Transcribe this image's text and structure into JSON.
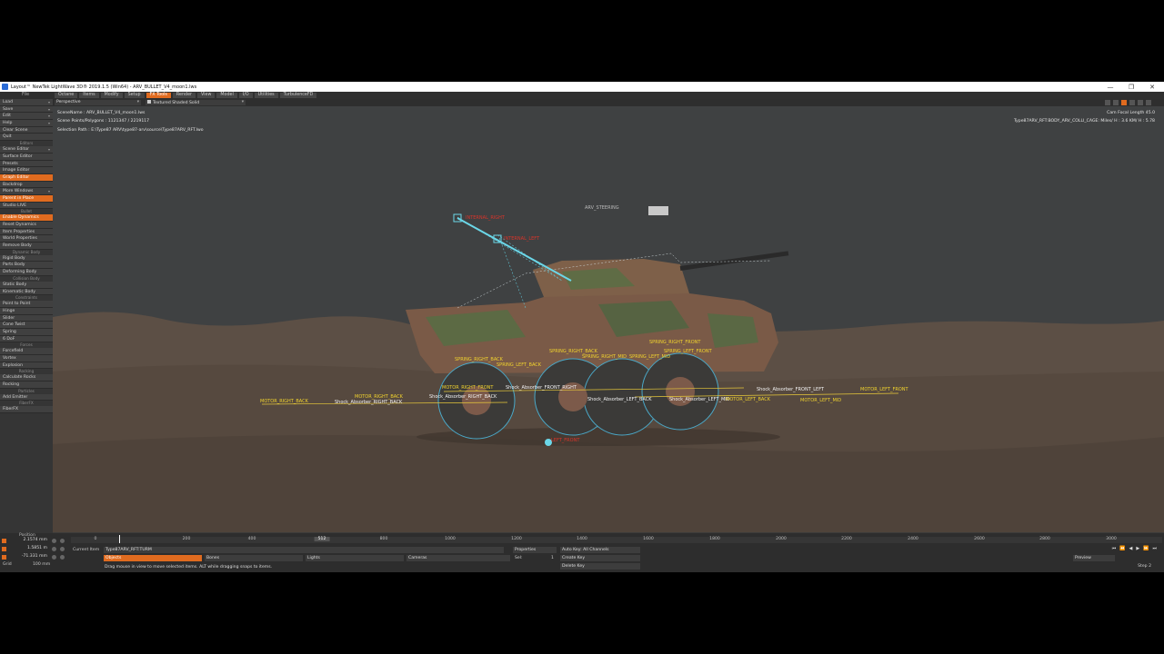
{
  "window": {
    "title": "Layout™ NewTek LightWave 3D® 2019.1.5 (Win64) - ARV_BULLET_V4_moon1.lws",
    "controls": [
      "—",
      "❐",
      "✕"
    ]
  },
  "menubar": {
    "file_label": "File",
    "tabs": [
      "Octane",
      "Items",
      "Modify",
      "Setup",
      "FX Tools",
      "Render",
      "View",
      "Model",
      "I/O",
      "Utilities",
      "TurbulenceFD"
    ],
    "active_tab": "FX Tools"
  },
  "sidebar": {
    "top": [
      "Load",
      "Save",
      "Edit",
      "Help"
    ],
    "clear": [
      "Clear Scene",
      "Quit"
    ],
    "editors_title": "Editors",
    "editors": [
      "Scene Editor",
      "Surface Editor",
      "Presets",
      "Image Editor",
      "Graph Editor",
      "Backdrop",
      "More Windows",
      "Parent in Place",
      "Studio LIVE"
    ],
    "bullet_title": "Bullet",
    "bullet": [
      "Enable Dynamics",
      "Reset Dynamics",
      "Item Properties",
      "World Properties",
      "Remove Body"
    ],
    "dynamic_title": "Dynamic Body",
    "dynamic": [
      "Rigid Body",
      "Parts Body",
      "Deforming Body"
    ],
    "collision_title": "Collision Body",
    "collision": [
      "Static Body",
      "Kinematic Body"
    ],
    "constraints_title": "Constraints",
    "constraints": [
      "Point to Point",
      "Hinge",
      "Slider",
      "Cone Twist",
      "Spring",
      "6 DoF"
    ],
    "forces_title": "Forces",
    "forces": [
      "Forcefield",
      "Vortex",
      "Explosion"
    ],
    "rocking_title": "Rocking",
    "rocking": [
      "Calculate Rocks",
      "Rocking"
    ],
    "particles_title": "Particles",
    "particles": [
      "Add Emitter"
    ],
    "fiberfx_title": "FiberFX",
    "fiberfx": [
      "FiberFX"
    ]
  },
  "viewport": {
    "view_mode": "Perspective",
    "shading": "Textured Shaded Solid",
    "scene_name": "SceneName   : ARV_BULLET_V4_moon1.lws",
    "points_polys": "Scene Points/Polygons : 1121347 / 2219117",
    "selection_path": "Selection Path : E:\\Type87 ARV\\type87-arv\\source\\Type87ARV_RFT.lwo",
    "cam_focal": "Cam Focal Length   45.0",
    "item_info": "Type87ARV_RFT:BODY_ARV_COLLI_CAGE: Miles/ H : 3.6  KM/ H : 5.78",
    "labels": {
      "steering": "ARV_STEERING",
      "internal_right": "INTERNAL_RIGHT",
      "internal_left": "INTERNAL_LEFT",
      "motor_right_back_far": "MOTOR_RIGHT_BACK",
      "motor_right_back": "MOTOR_RIGHT_BACK",
      "shock_right_back": "Shock_Absorber_RIGHT_BACK",
      "shock_right_back2": "Shock_Absorber_RIGHT_BACK",
      "motor_right_front": "MOTOR_RIGHT_FRONT",
      "shock_front_right": "Shock_Absorber_FRONT_RIGHT",
      "spring_right_back": "SPRING_RIGHT_BACK",
      "spring_left_back": "SPRING_LEFT_BACK",
      "spring_right_back2": "SPRING_RIGHT_BACK",
      "spring_right_mid": "SPRING_RIGHT_MID",
      "spring_left_mid": "SPRING_LEFT_MID",
      "spring_right_front": "SPRING_RIGHT_FRONT",
      "spring_left_front": "SPRING_LEFT_FRONT",
      "shock_left_back": "Shock_Absorber_LEFT_BACK",
      "shock_left_mid": "Shock_Absorber_LEFT_MID",
      "motor_left_back": "MOTOR_LEFT_BACK",
      "motor_left_mid": "MOTOR_LEFT_MID",
      "shock_front_left": "Shock_Absorber_FRONT_LEFT",
      "motor_left_front": "MOTOR_LEFT_FRONT",
      "left_front_red": "LEFT_FRONT"
    }
  },
  "timeline": {
    "position_label": "Position",
    "positions": [
      "2.1574 mm",
      "1.5851 m",
      "-71.331 mm"
    ],
    "grid_label": "Grid",
    "grid_value": "100 mm",
    "ticks": [
      "0",
      "200",
      "400",
      "512",
      "800",
      "1000",
      "1200",
      "1400",
      "1600",
      "1800",
      "2000",
      "2200",
      "2400",
      "2600",
      "2800",
      "3000"
    ],
    "current_frame": "512",
    "current_item_label": "Current Item",
    "current_item": "Type87ARV_RFT:TURM",
    "properties": "Properties",
    "auto_key": "Auto Key: All Channels",
    "objects": "Objects",
    "bones": "Bones",
    "lights": "Lights",
    "cameras": "Cameras",
    "sel_label": "Sel:",
    "sel_value": "1",
    "create_key": "Create Key",
    "delete_key": "Delete Key",
    "preview": "Preview",
    "step_label": "Step",
    "step_value": "2",
    "status": "Drag mouse in view to move selected items. ALT while dragging snaps to items."
  }
}
